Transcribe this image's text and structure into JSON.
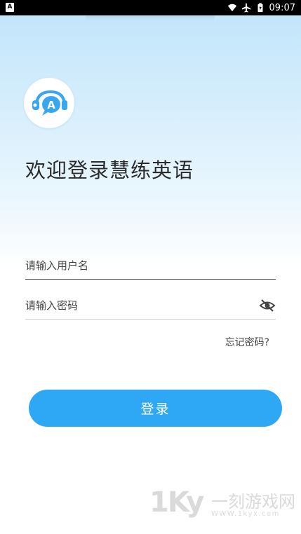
{
  "status_bar": {
    "app_badge": "A",
    "time": "09:07",
    "icons": [
      "wifi-icon",
      "airplane-icon",
      "battery-icon"
    ]
  },
  "app": {
    "logo_letter": "A",
    "welcome_text": "欢迎登录慧练英语"
  },
  "form": {
    "username_placeholder": "请输入用户名",
    "username_value": "",
    "password_placeholder": "请输入密码",
    "password_value": "",
    "forgot_password": "忘记密码?",
    "login_button": "登录"
  },
  "watermark": {
    "mark": "1Ky",
    "title": "一刻游戏网",
    "url": "WWW.1kyx.com"
  },
  "colors": {
    "accent": "#2ea8f5",
    "logo_blue": "#39a7ef",
    "status_bar_bg": "#000000"
  }
}
